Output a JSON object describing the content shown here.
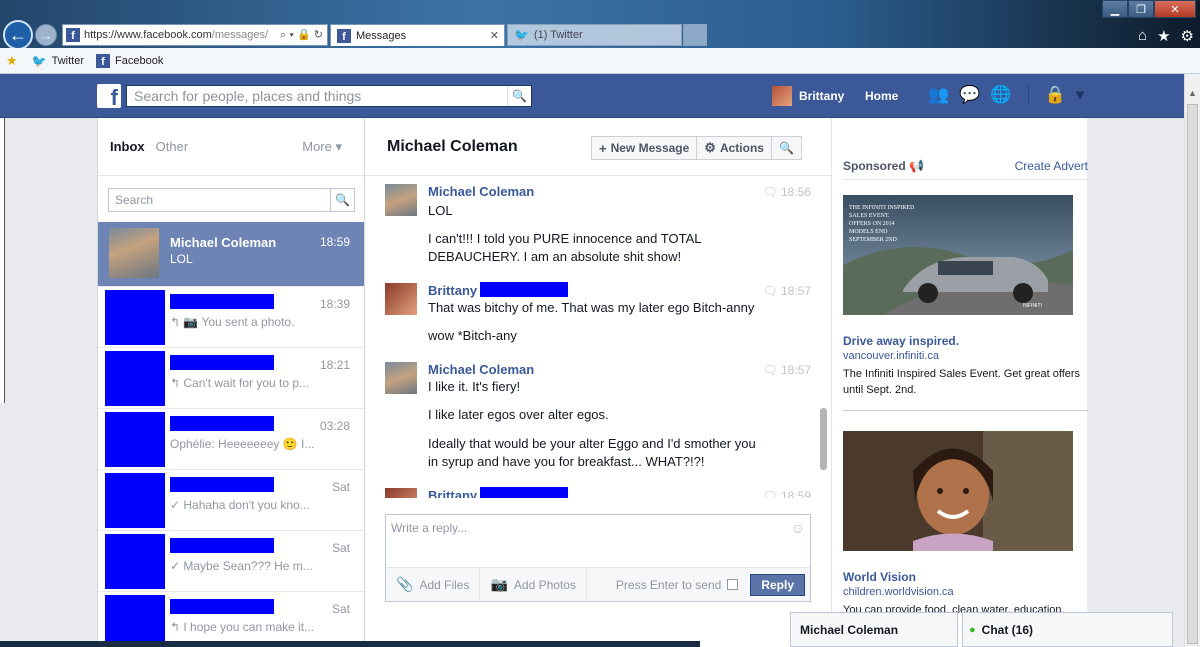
{
  "browser": {
    "url_prefix": "https://www.",
    "url_domain": "facebook.com",
    "url_path": "/messages/",
    "tabs": [
      {
        "label": "Messages"
      },
      {
        "label": "(1) Twitter"
      }
    ],
    "favorites": [
      {
        "label": "Twitter"
      },
      {
        "label": "Facebook"
      }
    ]
  },
  "fb": {
    "logo": "f",
    "search_placeholder": "Search for people, places and things",
    "user_name": "Brittany",
    "home_label": "Home"
  },
  "threads_panel": {
    "inbox": "Inbox",
    "other": "Other",
    "more": "More ▾",
    "search_placeholder": "Search",
    "threads": [
      {
        "name": "Michael Coleman",
        "time": "18:59",
        "snippet": "LOL"
      },
      {
        "name": "",
        "time": "18:39",
        "snippet": "↰ 📷 You sent a photo."
      },
      {
        "name": "",
        "time": "18:21",
        "snippet": "↰ Can't wait for you to p..."
      },
      {
        "name": "",
        "time": "03:28",
        "snippet": "Ophélie: Heeeeeeey 🙂 I..."
      },
      {
        "name": "",
        "time": "Sat",
        "snippet": "✓ Hahaha don't you kno..."
      },
      {
        "name": "",
        "time": "Sat",
        "snippet": "✓ Maybe Sean??? He m..."
      },
      {
        "name": "",
        "time": "Sat",
        "snippet": "↰ I hope you can make it..."
      }
    ]
  },
  "conversation": {
    "title": "Michael Coleman",
    "new_message": "New Message",
    "actions": "Actions",
    "messages": [
      {
        "sender": "Michael Coleman",
        "time": "18:56",
        "lines": [
          "LOL",
          "I can't!!! I told you PURE innocence and TOTAL",
          "DEBAUCHERY. I am an absolute shit show!"
        ]
      },
      {
        "sender": "Brittany",
        "time": "18:57",
        "lines": [
          "That was bitchy of me. That was my later ego Bitch-anny",
          "wow *Bitch-any"
        ]
      },
      {
        "sender": "Michael Coleman",
        "time": "18:57",
        "lines": [
          "I like it. It's fiery!",
          "I like later egos over alter egos.",
          "Ideally that would be your alter Eggo and I'd smother you",
          "in syrup and have you for breakfast... WHAT?!?!"
        ]
      },
      {
        "sender": "Brittany",
        "time": "18:59",
        "lines": []
      }
    ],
    "reply_placeholder": "Write a reply...",
    "add_files": "Add Files",
    "add_photos": "Add Photos",
    "press_enter": "Press Enter to send",
    "reply_button": "Reply"
  },
  "ads": {
    "sponsored": "Sponsored",
    "create_advert": "Create Advert",
    "items": [
      {
        "title": "Drive away inspired.",
        "host": "vancouver.infiniti.ca",
        "desc": "The Infiniti Inspired Sales Event. Get great offers until Sept. 2nd.",
        "image_text": "THE INFINITI INSPIRED SALES EVENT. OFFERS ON 2014 MODELS END SEPTEMBER 2ND",
        "brand": "INFINITI"
      },
      {
        "title": "World Vision",
        "host": "children.worldvision.ca",
        "desc": "You can provide food, clean water, education,"
      }
    ]
  },
  "chat": {
    "open_conversation": "Michael Coleman",
    "label": "Chat (16)"
  },
  "colors": {
    "fb_blue": "#3b5998",
    "active_thread": "#6d84b4",
    "redaction": "#0000ff"
  }
}
